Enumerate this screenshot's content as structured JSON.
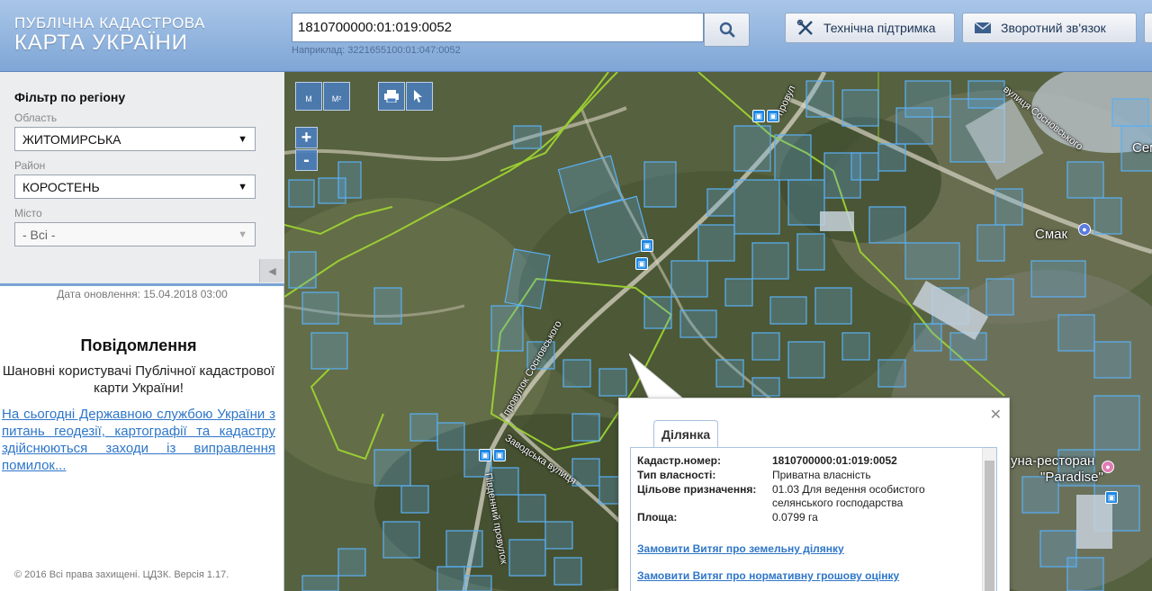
{
  "header": {
    "logo_line1": "ПУБЛІЧНА КАДАСТРОВА",
    "logo_line2": "КАРТА УКРАЇНИ",
    "search_value": "1810700000:01:019:0052",
    "search_hint": "Наприклад: 3221655100:01:047:0052",
    "support_label": "Технічна підтримка",
    "feedback_label": "Зворотний зв'язок"
  },
  "filter": {
    "title": "Фільтр по регіону",
    "region_label": "Область",
    "region_value": "ЖИТОМИРСЬКА",
    "district_label": "Район",
    "district_value": "КОРОСТЕНЬ",
    "city_label": "Місто",
    "city_value": "- Всі -"
  },
  "update_date": "Дата оновлення: 15.04.2018 03:00",
  "notice": {
    "title": "Повідомлення",
    "text": "Шановні користувачі Публічної кадастрової карти України!",
    "link": "На сьогодні Державною службою України з питань геодезії, картографії та кадастру здійснюються заходи із виправлення помилок..."
  },
  "footer": "© 2016 Всі права захищені. ЦДЗК. Версія 1.17.",
  "map_tools": {
    "length_label": "M",
    "area_label": "M²",
    "zoom_in": "+",
    "zoom_out": "-"
  },
  "map_labels": {
    "smak": "Смак",
    "restaurant_line1": "уна-ресторан",
    "restaurant_line2": "\"Paradise\"",
    "street1": "вулиця Сосновського",
    "street2": "провулок Сосновського",
    "street3": "Заводська вулиця",
    "street4": "Південний провулок",
    "street5": "провул",
    "edge_label": "Сем"
  },
  "popup": {
    "tab_label": "Ділянка",
    "rows": [
      {
        "key": "Кадастр.номер:",
        "value": "1810700000:01:019:0052"
      },
      {
        "key": "Тип власності:",
        "value": "Приватна власність"
      },
      {
        "key": "Цільове призначення:",
        "value": "01.03 Для ведення особистого селянського господарства"
      },
      {
        "key": "Площа:",
        "value": "0.0799 га"
      }
    ],
    "link1": "Замовити Витяг про земельну ділянку",
    "link2": "Замовити Витяг про нормативну грошову оцінку"
  },
  "colors": {
    "header_top": "#a9c6e8",
    "header_bottom": "#7fa6d6",
    "accent": "#2e76c9",
    "boundary_line": "#9acd32",
    "parcel_stroke": "#5ab0f5"
  }
}
